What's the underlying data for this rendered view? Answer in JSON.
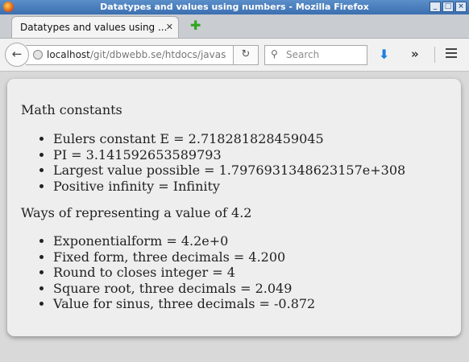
{
  "window": {
    "title": "Datatypes and values using numbers - Mozilla Firefox"
  },
  "tab": {
    "label": "Datatypes and values using ..."
  },
  "urlbar": {
    "host": "localhost",
    "path": "/git/dbwebb.se/htdocs/javas"
  },
  "search": {
    "placeholder": "Search"
  },
  "icons": {
    "back": "back-arrow-icon",
    "reload": "reload-icon",
    "search": "search-icon",
    "download": "download-icon",
    "overflow": "overflow-icon",
    "menu": "hamburger-menu-icon",
    "new_tab": "plus-icon",
    "close": "close-icon",
    "site": "globe-icon"
  },
  "page": {
    "math_title": "Math constants",
    "math_items": [
      "Eulers constant E = 2.718281828459045",
      "PI = 3.141592653589793",
      "Largest value possible = 1.7976931348623157e+308",
      "Positive infinity = Infinity"
    ],
    "ways_title": "Ways of representing a value of 4.2",
    "ways_items": [
      "Exponentialform = 4.2e+0",
      "Fixed form, three decimals = 4.200",
      "Round to closes integer = 4",
      "Square root, three decimals = 2.049",
      "Value for sinus, three decimals = -0.872"
    ]
  }
}
